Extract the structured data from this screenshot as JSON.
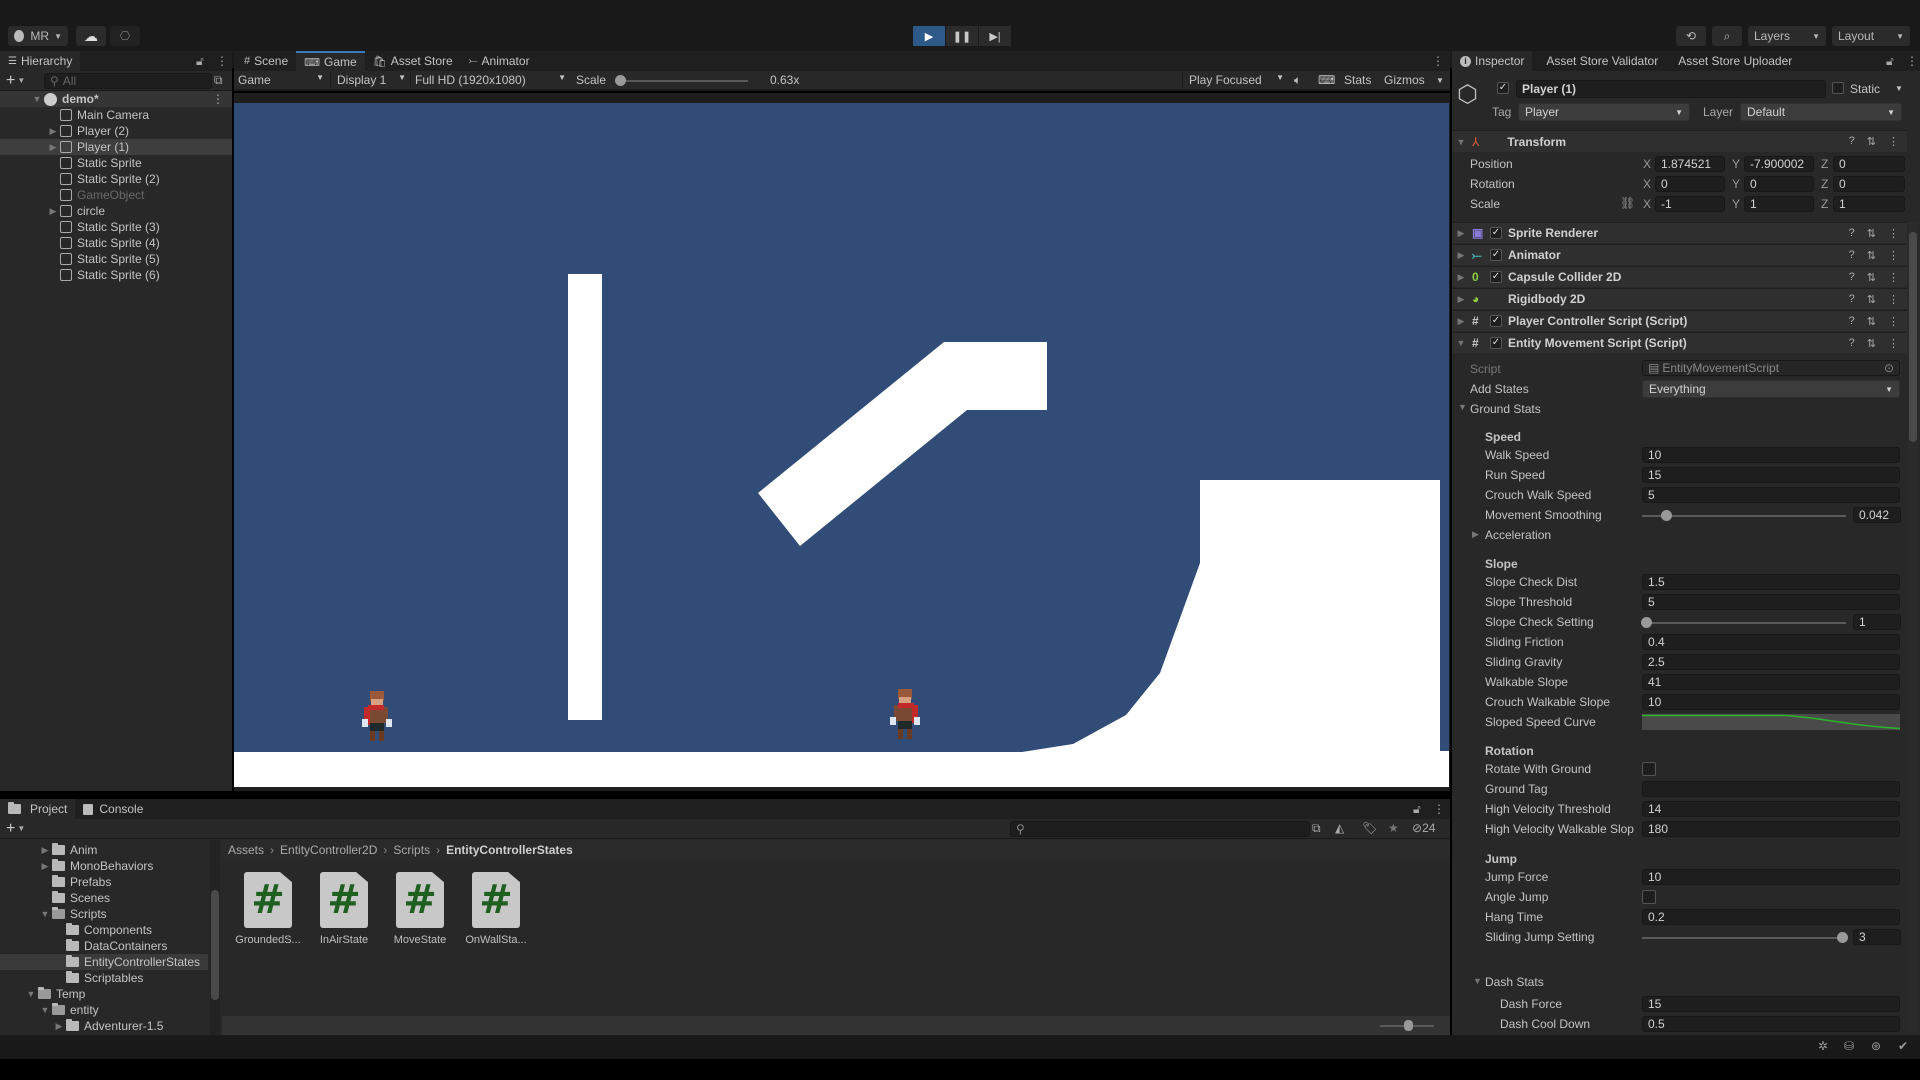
{
  "topbar": {
    "account": "MR",
    "layers_label": "Layers",
    "layout_label": "Layout"
  },
  "hierarchy": {
    "tab_label": "Hierarchy",
    "search_placeholder": "All",
    "scene_name": "demo*",
    "items": [
      {
        "label": "Main Camera",
        "expandable": false,
        "selected": false,
        "dim": false
      },
      {
        "label": "Player (2)",
        "expandable": true,
        "selected": false,
        "dim": false
      },
      {
        "label": "Player (1)",
        "expandable": true,
        "selected": true,
        "dim": false
      },
      {
        "label": "Static Sprite",
        "expandable": false,
        "selected": false,
        "dim": false
      },
      {
        "label": "Static Sprite (2)",
        "expandable": false,
        "selected": false,
        "dim": false
      },
      {
        "label": "GameObject",
        "expandable": false,
        "selected": false,
        "dim": true
      },
      {
        "label": "circle",
        "expandable": true,
        "selected": false,
        "dim": false
      },
      {
        "label": "Static Sprite (3)",
        "expandable": false,
        "selected": false,
        "dim": false
      },
      {
        "label": "Static Sprite (4)",
        "expandable": false,
        "selected": false,
        "dim": false
      },
      {
        "label": "Static Sprite (5)",
        "expandable": false,
        "selected": false,
        "dim": false
      },
      {
        "label": "Static Sprite (6)",
        "expandable": false,
        "selected": false,
        "dim": false
      }
    ]
  },
  "center": {
    "tabs": [
      {
        "label": "Scene",
        "icon": "#"
      },
      {
        "label": "Game",
        "icon": "⌨"
      },
      {
        "label": "Asset Store",
        "icon": "🛍"
      },
      {
        "label": "Animator",
        "icon": "⤚"
      }
    ],
    "active_tab": "Game",
    "toolbar": {
      "view_mode": "Game",
      "display": "Display 1",
      "resolution": "Full HD (1920x1080)",
      "scale_label": "Scale",
      "scale_value": "0.63x",
      "play_mode": "Play Focused",
      "stats_label": "Stats",
      "gizmos_label": "Gizmos"
    },
    "game_colors": {
      "background": "#314d77",
      "sprites": "#ffffff"
    }
  },
  "project": {
    "tabs": [
      "Project",
      "Console"
    ],
    "tree": [
      {
        "label": "Anim",
        "indent": 1,
        "expandable": true,
        "open": false,
        "selected": false
      },
      {
        "label": "MonoBehaviors",
        "indent": 1,
        "expandable": true,
        "open": false,
        "selected": false
      },
      {
        "label": "Prefabs",
        "indent": 1,
        "expandable": false,
        "open": false,
        "selected": false
      },
      {
        "label": "Scenes",
        "indent": 1,
        "expandable": false,
        "open": false,
        "selected": false
      },
      {
        "label": "Scripts",
        "indent": 1,
        "expandable": true,
        "open": true,
        "selected": false
      },
      {
        "label": "Components",
        "indent": 2,
        "expandable": false,
        "open": false,
        "selected": false
      },
      {
        "label": "DataContainers",
        "indent": 2,
        "expandable": false,
        "open": false,
        "selected": false
      },
      {
        "label": "EntityControllerStates",
        "indent": 2,
        "expandable": false,
        "open": false,
        "selected": true
      },
      {
        "label": "Scriptables",
        "indent": 2,
        "expandable": false,
        "open": false,
        "selected": false
      },
      {
        "label": "Temp",
        "indent": 0,
        "expandable": true,
        "open": true,
        "selected": false
      },
      {
        "label": "entity",
        "indent": 1,
        "expandable": true,
        "open": true,
        "selected": false
      },
      {
        "label": "Adventurer-1.5",
        "indent": 2,
        "expandable": true,
        "open": false,
        "selected": false
      }
    ],
    "breadcrumb": [
      "Assets",
      "EntityController2D",
      "Scripts",
      "EntityControllerStates"
    ],
    "hidden_count": "24",
    "assets": [
      "GroundedS...",
      "InAirState",
      "MoveState",
      "OnWallSta..."
    ]
  },
  "inspector": {
    "tabs": [
      "Inspector",
      "Asset Store Validator",
      "Asset Store Uploader"
    ],
    "object_name": "Player (1)",
    "static_label": "Static",
    "tag_label": "Tag",
    "tag_value": "Player",
    "layer_label": "Layer",
    "layer_value": "Default",
    "transform": {
      "title": "Transform",
      "position": {
        "label": "Position",
        "x": "1.874521",
        "y": "-7.900002",
        "z": "0"
      },
      "rotation": {
        "label": "Rotation",
        "x": "0",
        "y": "0",
        "z": "0"
      },
      "scale": {
        "label": "Scale",
        "x": "-1",
        "y": "1",
        "z": "1"
      }
    },
    "components": [
      {
        "name": "Sprite Renderer",
        "checkbox": true,
        "icon": "sprite-renderer-icon"
      },
      {
        "name": "Animator",
        "checkbox": true,
        "icon": "animator-icon"
      },
      {
        "name": "Capsule Collider 2D",
        "checkbox": true,
        "icon": "capsule-collider-icon"
      },
      {
        "name": "Rigidbody 2D",
        "checkbox": false,
        "icon": "rigidbody-icon"
      },
      {
        "name": "Player Controller Script (Script)",
        "checkbox": true,
        "icon": "script-icon"
      },
      {
        "name": "Entity Movement Script (Script)",
        "checkbox": true,
        "icon": "script-icon"
      }
    ],
    "script": {
      "label": "Script",
      "value": "EntityMovementScript"
    },
    "add_states": {
      "label": "Add States",
      "value": "Everything"
    },
    "ground_stats_label": "Ground Stats",
    "speed": {
      "header": "Speed",
      "walk_speed": {
        "label": "Walk Speed",
        "value": "10"
      },
      "run_speed": {
        "label": "Run Speed",
        "value": "15"
      },
      "crouch_walk_speed": {
        "label": "Crouch Walk Speed",
        "value": "5"
      },
      "movement_smoothing": {
        "label": "Movement Smoothing",
        "value": "0.042",
        "fraction": 0.1
      },
      "acceleration": "Acceleration"
    },
    "slope": {
      "header": "Slope",
      "slope_check_dist": {
        "label": "Slope Check Dist",
        "value": "1.5"
      },
      "slope_threshold": {
        "label": "Slope Threshold",
        "value": "5"
      },
      "slope_check_setting": {
        "label": "Slope Check Setting",
        "value": "1",
        "fraction": 0.0
      },
      "sliding_friction": {
        "label": "Sliding Friction",
        "value": "0.4"
      },
      "sliding_gravity": {
        "label": "Sliding Gravity",
        "value": "2.5"
      },
      "walkable_slope": {
        "label": "Walkable Slope",
        "value": "41"
      },
      "crouch_walkable_slope": {
        "label": "Crouch Walkable Slope",
        "value": "10"
      },
      "sloped_speed_curve": {
        "label": "Sloped Speed Curve",
        "color": "#2bb52b"
      }
    },
    "rotation": {
      "header": "Rotation",
      "rotate_with_ground": {
        "label": "Rotate With Ground",
        "checked": false
      },
      "ground_tag": {
        "label": "Ground Tag",
        "value": ""
      },
      "high_velocity_threshold": {
        "label": "High Velocity Threshold",
        "value": "14"
      },
      "high_velocity_walkable_slope": {
        "label": "High Velocity Walkable Slop",
        "value": "180"
      }
    },
    "jump": {
      "header": "Jump",
      "jump_force": {
        "label": "Jump Force",
        "value": "10"
      },
      "angle_jump": {
        "label": "Angle Jump",
        "checked": false
      },
      "hang_time": {
        "label": "Hang Time",
        "value": "0.2"
      },
      "sliding_jump_setting": {
        "label": "Sliding Jump Setting",
        "value": "3",
        "fraction": 1.0
      }
    },
    "dash": {
      "header": "Dash Stats",
      "dash_force": {
        "label": "Dash Force",
        "value": "15"
      },
      "dash_cool_down": {
        "label": "Dash Cool Down",
        "value": "0.5"
      }
    }
  }
}
